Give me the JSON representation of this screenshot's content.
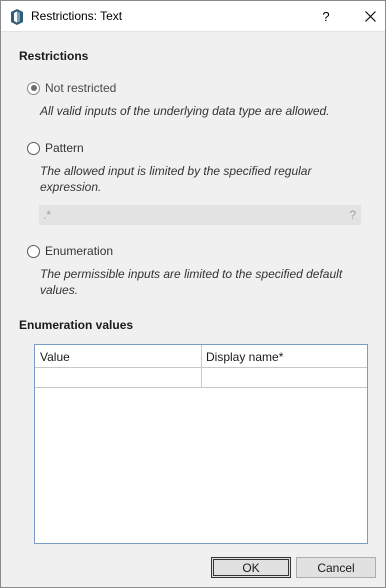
{
  "window": {
    "title": "Restrictions: Text",
    "help_label": "?"
  },
  "restrictions": {
    "heading": "Restrictions",
    "not_restricted": {
      "label": "Not restricted",
      "selected": true,
      "description": "All valid inputs of the underlying data type are allowed."
    },
    "pattern": {
      "label": "Pattern",
      "selected": false,
      "description": "The allowed input is limited by the specified regular expression.",
      "input_placeholder": ".*",
      "input_help": "?"
    },
    "enumeration": {
      "label": "Enumeration",
      "selected": false,
      "description": "The permissible inputs are limited to the specified default values."
    }
  },
  "enumeration_values": {
    "heading": "Enumeration values",
    "columns": [
      "Value",
      "Display name*"
    ],
    "rows": [
      [
        "",
        ""
      ]
    ]
  },
  "buttons": {
    "ok": "OK",
    "cancel": "Cancel"
  },
  "colors": {
    "title_bar": "#ffffff",
    "dialog_bg": "#f0f0f0",
    "table_border": "#7a9cc6",
    "app_icon": "#2f5f77"
  }
}
